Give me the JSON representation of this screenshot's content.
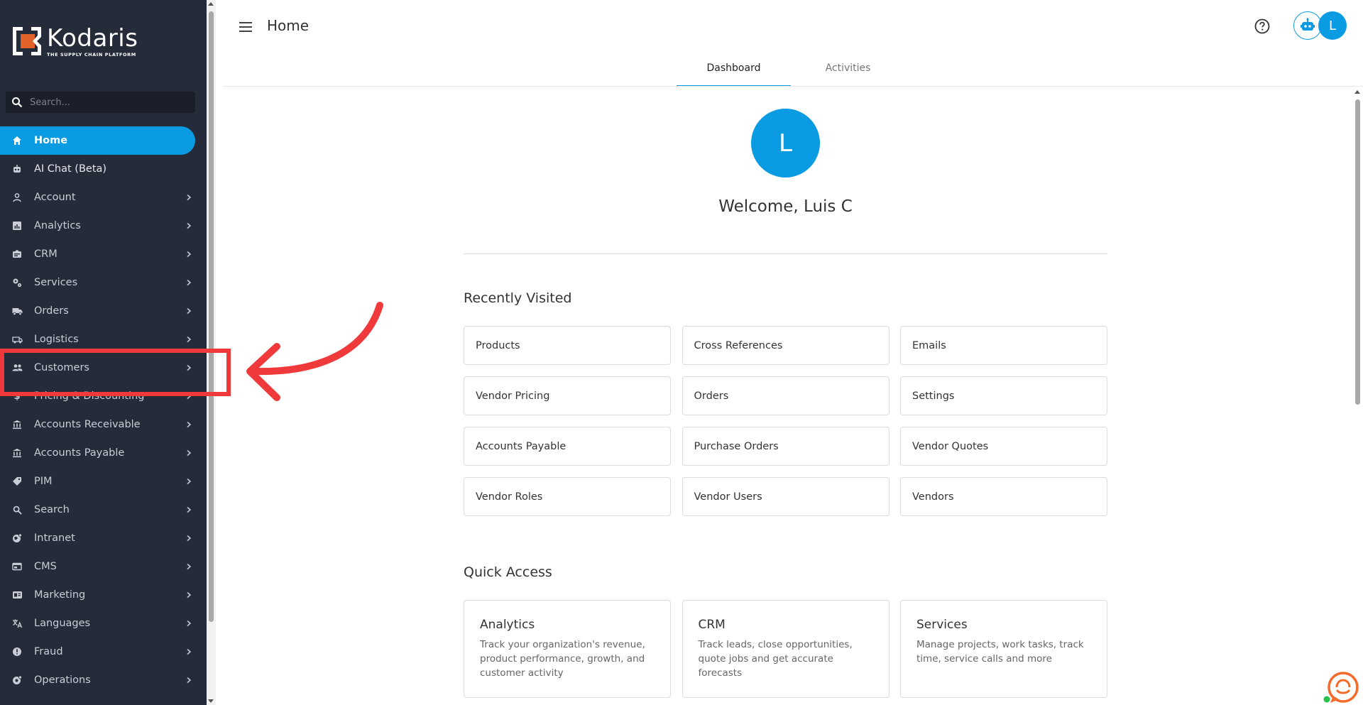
{
  "brand": {
    "name": "Kodaris",
    "tagline": "THE SUPPLY CHAIN PLATFORM",
    "accent_color": "#0a9be2",
    "sidebar_color": "#252b38",
    "annotation_color": "#f0393a"
  },
  "sidebar": {
    "search_placeholder": "Search...",
    "items": [
      {
        "label": "Home",
        "icon": "home-icon",
        "active": true,
        "chevron": false
      },
      {
        "label": "AI Chat (Beta)",
        "icon": "robot-icon",
        "active": false,
        "chevron": false
      },
      {
        "label": "Account",
        "icon": "user-icon",
        "active": false,
        "chevron": true
      },
      {
        "label": "Analytics",
        "icon": "analytics-icon",
        "active": false,
        "chevron": true
      },
      {
        "label": "CRM",
        "icon": "crm-icon",
        "active": false,
        "chevron": true
      },
      {
        "label": "Services",
        "icon": "gears-icon",
        "active": false,
        "chevron": true
      },
      {
        "label": "Orders",
        "icon": "truck-icon",
        "active": false,
        "chevron": true
      },
      {
        "label": "Logistics",
        "icon": "logistics-icon",
        "active": false,
        "chevron": true
      },
      {
        "label": "Customers",
        "icon": "people-icon",
        "active": false,
        "chevron": true
      },
      {
        "label": "Pricing & Discounting",
        "icon": "dollar-icon",
        "active": false,
        "chevron": true
      },
      {
        "label": "Accounts Receivable",
        "icon": "bank-icon",
        "active": false,
        "chevron": true
      },
      {
        "label": "Accounts Payable",
        "icon": "bank-icon",
        "active": false,
        "chevron": true
      },
      {
        "label": "PIM",
        "icon": "tag-icon",
        "active": false,
        "chevron": true
      },
      {
        "label": "Search",
        "icon": "search-icon",
        "active": false,
        "chevron": true
      },
      {
        "label": "Intranet",
        "icon": "globe-icon",
        "active": false,
        "chevron": true
      },
      {
        "label": "CMS",
        "icon": "cms-icon",
        "active": false,
        "chevron": true
      },
      {
        "label": "Marketing",
        "icon": "marketing-icon",
        "active": false,
        "chevron": true
      },
      {
        "label": "Languages",
        "icon": "translate-icon",
        "active": false,
        "chevron": true
      },
      {
        "label": "Fraud",
        "icon": "alert-icon",
        "active": false,
        "chevron": true
      },
      {
        "label": "Operations",
        "icon": "operations-icon",
        "active": false,
        "chevron": true
      }
    ]
  },
  "header": {
    "title": "Home",
    "avatar_initial": "L",
    "tabs": [
      {
        "label": "Dashboard",
        "active": true
      },
      {
        "label": "Activities",
        "active": false
      }
    ]
  },
  "main": {
    "avatar_initial": "L",
    "welcome": "Welcome, Luis C",
    "recently_visited": {
      "title": "Recently Visited",
      "items": [
        "Products",
        "Cross References",
        "Emails",
        "Vendor Pricing",
        "Orders",
        "Settings",
        "Accounts Payable",
        "Purchase Orders",
        "Vendor Quotes",
        "Vendor Roles",
        "Vendor Users",
        "Vendors"
      ]
    },
    "quick_access": {
      "title": "Quick Access",
      "items": [
        {
          "title": "Analytics",
          "desc": "Track your organization's revenue, product performance, growth, and customer activity"
        },
        {
          "title": "CRM",
          "desc": "Track leads, close opportunities, quote jobs and get accurate forecasts"
        },
        {
          "title": "Services",
          "desc": "Manage projects, work tasks, track time, service calls and more"
        }
      ]
    }
  }
}
